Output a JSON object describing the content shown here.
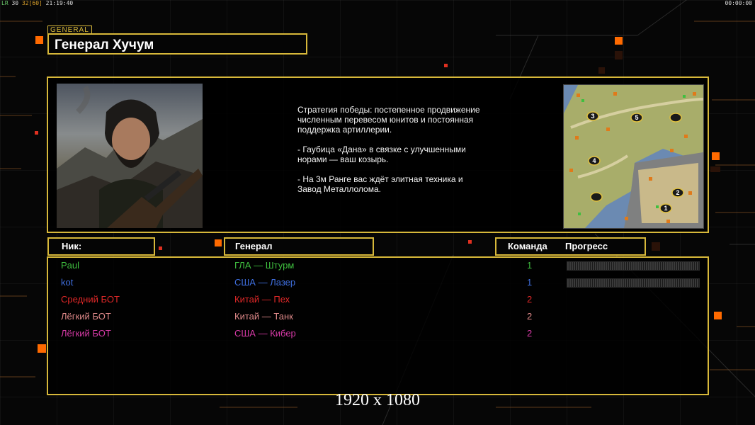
{
  "hud": {
    "left_label": "LR",
    "left_fps": "30",
    "left_limit": "32[60]",
    "left_clock": "21:19:40",
    "right_timer": "00:00:00"
  },
  "header": {
    "tag": "GENERAL",
    "general_name": "Генерал Хучум"
  },
  "strategy": {
    "paragraphs": [
      "Стратегия победы: постепенное продвижение численным перевесом юнитов и постоянная поддержка артиллерии.",
      "- Гаубица «Дана» в связке с улучшенными норами — ваш козырь.",
      "- На 3м Ранге вас ждёт элитная техника и Завод Металлолома."
    ]
  },
  "minimap": {
    "start_positions": [
      "1",
      "2",
      "3",
      "4",
      "5"
    ]
  },
  "columns": {
    "nick": "Ник:",
    "general": "Генерал",
    "team": "Команда",
    "progress": "Прогресс"
  },
  "players": [
    {
      "nick": "Paul",
      "general": "ГЛА — Штурм",
      "team": "1",
      "color": "#3fbf3f",
      "progress_bar": true
    },
    {
      "nick": "kot",
      "general": "США — Лазер",
      "team": "1",
      "color": "#3f6fe0",
      "progress_bar": true
    },
    {
      "nick": "Средний БОТ",
      "general": "Китай — Пех",
      "team": "2",
      "color": "#e02828",
      "progress_bar": false
    },
    {
      "nick": "Лёгкий БОТ",
      "general": "Китай — Танк",
      "team": "2",
      "color": "#e08a8a",
      "progress_bar": false
    },
    {
      "nick": "Лёгкий БОТ",
      "general": "США — Кибер",
      "team": "2",
      "color": "#d63aa6",
      "progress_bar": false
    }
  ],
  "resolution_caption": "1920 x 1080",
  "colors": {
    "frame": "#d7b83a",
    "accent_orange": "#ff6a00"
  }
}
